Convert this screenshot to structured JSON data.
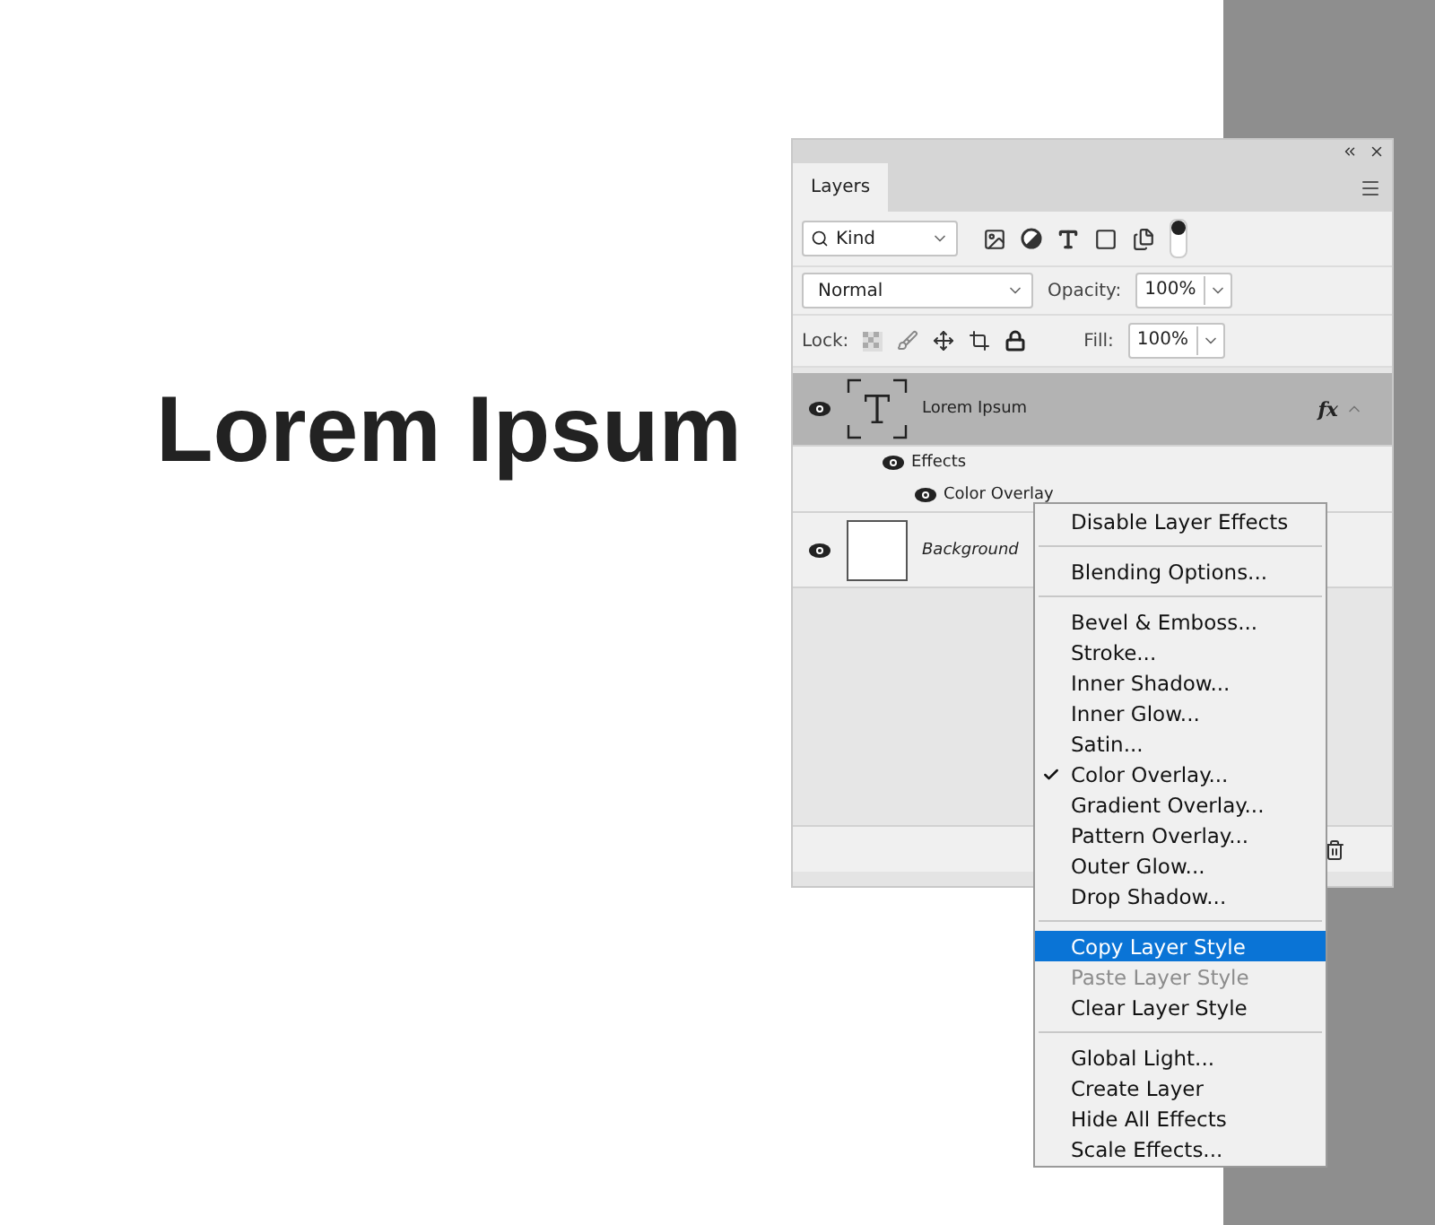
{
  "canvas": {
    "heading": "Lorem Ipsum"
  },
  "panel": {
    "tabs": [
      {
        "label": "Layers",
        "selected": true
      }
    ],
    "filter": {
      "value": "Kind"
    },
    "blend_mode": {
      "value": "Normal"
    },
    "opacity": {
      "label": "Opacity:",
      "value": "100%"
    },
    "lock": {
      "label": "Lock:"
    },
    "fill": {
      "label": "Fill:",
      "value": "100%"
    },
    "layers": [
      {
        "name": "Lorem Ipsum",
        "kind": "text",
        "selected": true,
        "badge": "fx",
        "effects": {
          "label": "Effects",
          "children": [
            {
              "name": "Color Overlay"
            }
          ]
        }
      },
      {
        "name": "Background",
        "kind": "image",
        "selected": false
      }
    ]
  },
  "context_menu": {
    "groups": [
      [
        {
          "label": "Disable Layer Effects",
          "checked": false,
          "selected": false,
          "disabled": false
        }
      ],
      [
        {
          "label": "Blending Options...",
          "checked": false,
          "selected": false,
          "disabled": false
        }
      ],
      [
        {
          "label": "Bevel & Emboss...",
          "checked": false,
          "selected": false,
          "disabled": false
        },
        {
          "label": "Stroke...",
          "checked": false,
          "selected": false,
          "disabled": false
        },
        {
          "label": "Inner Shadow...",
          "checked": false,
          "selected": false,
          "disabled": false
        },
        {
          "label": "Inner Glow...",
          "checked": false,
          "selected": false,
          "disabled": false
        },
        {
          "label": "Satin...",
          "checked": false,
          "selected": false,
          "disabled": false
        },
        {
          "label": "Color Overlay...",
          "checked": true,
          "selected": false,
          "disabled": false
        },
        {
          "label": "Gradient Overlay...",
          "checked": false,
          "selected": false,
          "disabled": false
        },
        {
          "label": "Pattern Overlay...",
          "checked": false,
          "selected": false,
          "disabled": false
        },
        {
          "label": "Outer Glow...",
          "checked": false,
          "selected": false,
          "disabled": false
        },
        {
          "label": "Drop Shadow...",
          "checked": false,
          "selected": false,
          "disabled": false
        }
      ],
      [
        {
          "label": "Copy Layer Style",
          "checked": false,
          "selected": true,
          "disabled": false
        },
        {
          "label": "Paste Layer Style",
          "checked": false,
          "selected": false,
          "disabled": true
        },
        {
          "label": "Clear Layer Style",
          "checked": false,
          "selected": false,
          "disabled": false
        }
      ],
      [
        {
          "label": "Global Light...",
          "checked": false,
          "selected": false,
          "disabled": false
        },
        {
          "label": "Create Layer",
          "checked": false,
          "selected": false,
          "disabled": false
        },
        {
          "label": "Hide All Effects",
          "checked": false,
          "selected": false,
          "disabled": false
        },
        {
          "label": "Scale Effects...",
          "checked": false,
          "selected": false,
          "disabled": false
        }
      ]
    ]
  }
}
